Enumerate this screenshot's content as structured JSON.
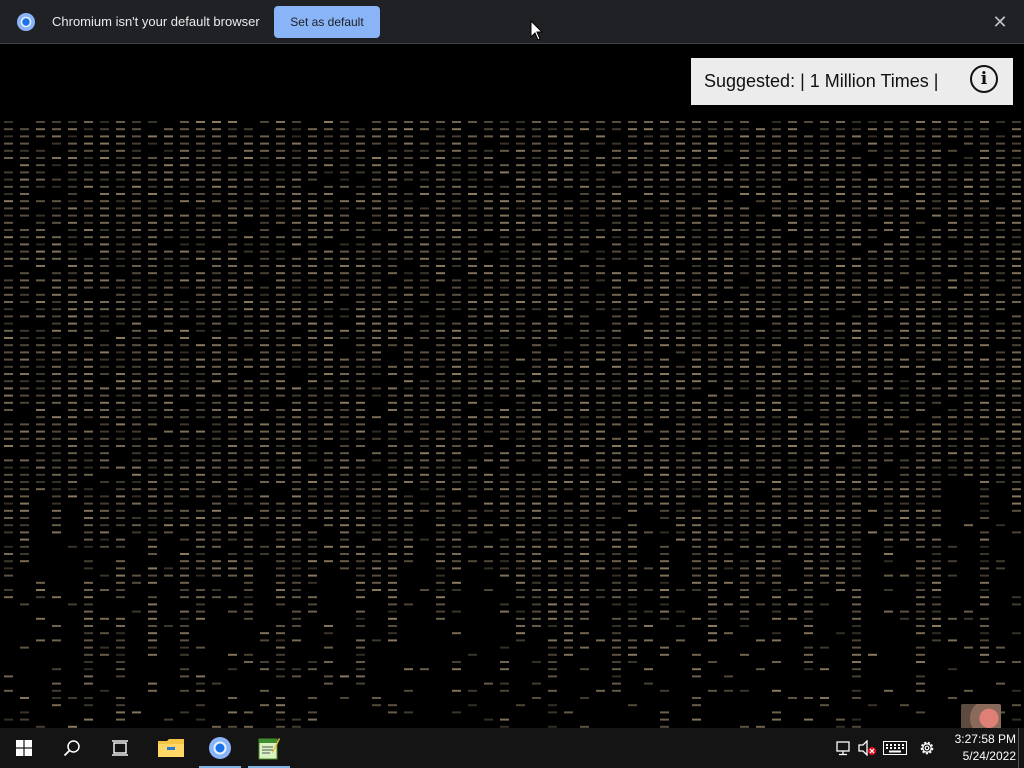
{
  "infobar": {
    "message": "Chromium isn't your default browser",
    "set_default_label": "Set as default",
    "close_glyph": "✕",
    "logo_icon": "chromium-icon"
  },
  "page": {
    "background_color": "#000000",
    "matrix_color": "#c4ae8a",
    "suggestion": {
      "text": "Suggested: | 1 Million Times |",
      "info_glyph": "i",
      "info_icon": "info-icon"
    }
  },
  "taskbar": {
    "pinned": [
      {
        "name": "start-button",
        "icon": "windows-logo-icon"
      },
      {
        "name": "search-button",
        "icon": "search-icon"
      },
      {
        "name": "task-view-button",
        "icon": "task-view-icon"
      },
      {
        "name": "file-explorer-button",
        "icon": "folder-icon"
      },
      {
        "name": "chromium-taskbar-button",
        "icon": "chromium-icon",
        "active": true
      },
      {
        "name": "notepad-taskbar-button",
        "icon": "notepad-icon",
        "active": true
      }
    ],
    "tray": {
      "icons": [
        "network-icon",
        "volume-muted-icon",
        "keyboard-icon",
        "settings-icon"
      ]
    },
    "clock": {
      "time": "3:27:58 PM",
      "date": "5/24/2022"
    },
    "accent_color": "#7fb6e5"
  }
}
